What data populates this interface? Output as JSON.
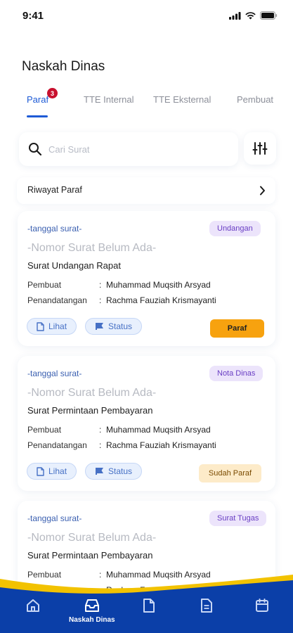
{
  "status_bar": {
    "time": "9:41",
    "icons": [
      "signal-icon",
      "wifi-icon",
      "battery-icon"
    ]
  },
  "header": {
    "title": "Naskah Dinas"
  },
  "tabs": [
    {
      "label": "Paraf",
      "badge": "3",
      "active": true
    },
    {
      "label": "TTE Internal"
    },
    {
      "label": "TTE Eksternal"
    },
    {
      "label": "Pembuat"
    }
  ],
  "search": {
    "placeholder": "Cari Surat",
    "value": ""
  },
  "history": {
    "label": "Riwayat Paraf"
  },
  "labels": {
    "pembuat": "Pembuat",
    "penandatangan": "Penandatangan",
    "colon": ":",
    "lihat": "Lihat",
    "status": "Status"
  },
  "cards": [
    {
      "date": "-tanggal surat-",
      "type": "Undangan",
      "number": "-Nomor Surat Belum Ada-",
      "subject": "Surat Undangan Rapat",
      "pembuat": "Muhammad Muqsith Arsyad",
      "penandatangan": "Rachma Fauziah Krismayanti",
      "action": "Paraf"
    },
    {
      "date": "-tanggal surat-",
      "type": "Nota Dinas",
      "number": "-Nomor Surat Belum Ada-",
      "subject": "Surat Permintaan Pembayaran",
      "pembuat": "Muhammad Muqsith Arsyad",
      "penandatangan": "Rachma Fauziah Krismayanti",
      "action": "Sudah Paraf"
    },
    {
      "date": "-tanggal surat-",
      "type": "Surat Tugas",
      "number": "-Nomor Surat Belum Ada-",
      "subject": "Surat Permintaan Pembayaran",
      "pembuat": "Muhammad Muqsith Arsyad",
      "penandatangan": "Rachma Fauziah Krismayanti"
    }
  ],
  "bottom_nav": [
    {
      "icon": "home-icon"
    },
    {
      "icon": "inbox-icon",
      "label": "Naskah Dinas",
      "active": true
    },
    {
      "icon": "document-icon"
    },
    {
      "icon": "document-list-icon"
    },
    {
      "icon": "calendar-icon"
    }
  ],
  "colors": {
    "accent": "#1e5bd6",
    "nav_bg": "#0b3fa8",
    "wave": "#f2c200",
    "badge": "#c8102e",
    "paraf_button": "#f7a20f"
  }
}
